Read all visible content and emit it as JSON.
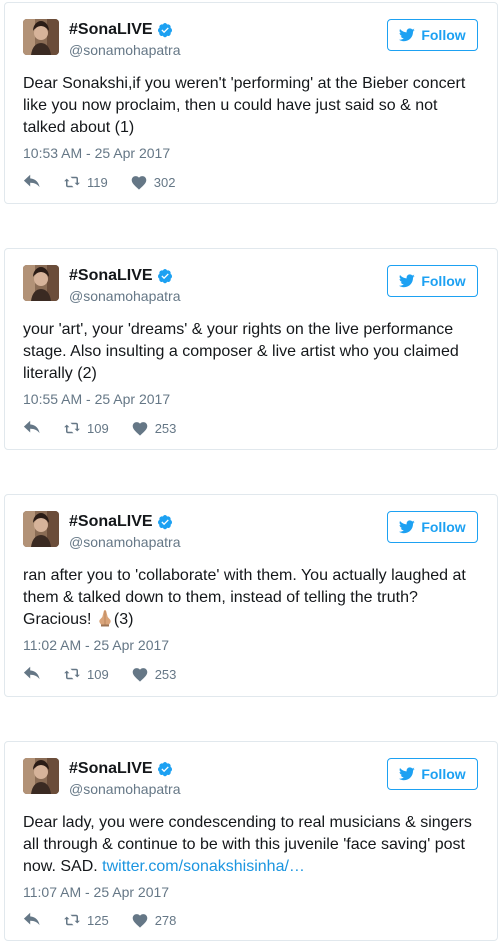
{
  "tweets": [
    {
      "name": "#SonaLIVE",
      "handle": "@sonamohapatra",
      "follow_label": "Follow",
      "text": "Dear Sonakshi,if you weren't 'performing' at the Bieber concert like you now proclaim, then u could have just said so & not talked about (1)",
      "time": "10:53 AM - 25 Apr 2017",
      "retweets": "119",
      "likes": "302"
    },
    {
      "name": "#SonaLIVE",
      "handle": "@sonamohapatra",
      "follow_label": "Follow",
      "text": "your 'art', your 'dreams' & your rights on the live performance stage. Also insulting a composer & live artist who you claimed literally (2)",
      "time": "10:55 AM - 25 Apr 2017",
      "retweets": "109",
      "likes": "253"
    },
    {
      "name": "#SonaLIVE",
      "handle": "@sonamohapatra",
      "follow_label": "Follow",
      "text_before_emoji": "ran after you to 'collaborate' with them. You actually laughed at them & talked down to them, instead of telling the truth? Gracious! ",
      "text_after_emoji": "(3)",
      "emoji_icon": "folded-hands-emoji",
      "time": "11:02 AM - 25 Apr 2017",
      "retweets": "109",
      "likes": "253"
    },
    {
      "name": "#SonaLIVE",
      "handle": "@sonamohapatra",
      "follow_label": "Follow",
      "text": "Dear lady, you were condescending to real musicians & singers all through & continue to be with this juvenile 'face saving' post now. SAD. ",
      "link": "twitter.com/sonakshisinha/…",
      "time": "11:07 AM - 25 Apr 2017",
      "retweets": "125",
      "likes": "278"
    }
  ],
  "colors": {
    "accent": "#1da1f2",
    "link": "#1b95e0",
    "muted": "#657786",
    "border": "#e1e8ed"
  },
  "icons": [
    "twitter-bird-icon",
    "verified-badge-icon",
    "reply-icon",
    "retweet-icon",
    "heart-icon"
  ]
}
